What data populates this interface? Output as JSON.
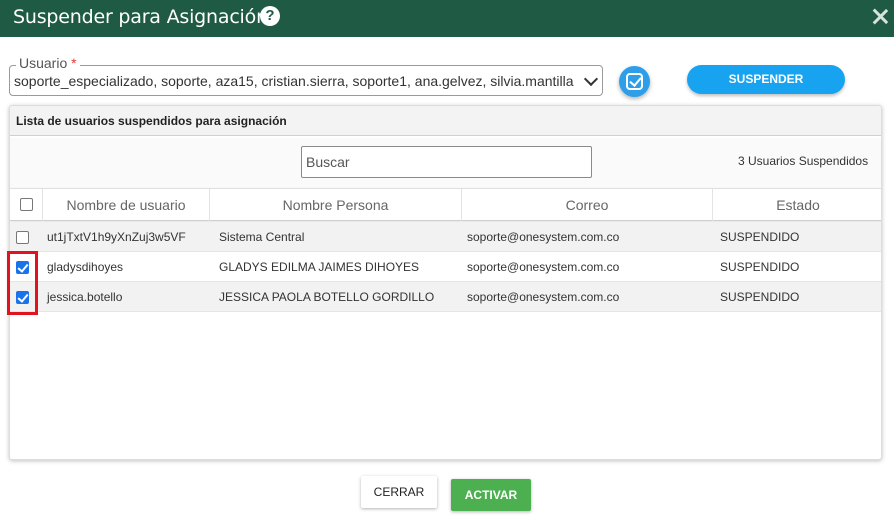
{
  "dialog": {
    "title": "Suspender para Asignación",
    "help_icon": "question-circle-icon",
    "help_glyph": "?",
    "close_icon": "close-icon"
  },
  "user_field": {
    "label": "Usuario",
    "required_mark": "*",
    "value": "soporte_especializado, soporte, aza15, cristian.sierra, soporte1, ana.gelvez, silvia.mantilla, ..."
  },
  "toolbar": {
    "select_all_icon": "check-square-icon",
    "suspend_label": "SUSPENDER"
  },
  "panel": {
    "title": "Lista de usuarios suspendidos para asignación",
    "search_placeholder": "Buscar",
    "count_text": "3 Usuarios Suspendidos",
    "columns": [
      "Nombre de usuario",
      "Nombre Persona",
      "Correo",
      "Estado"
    ],
    "rows": [
      {
        "username": "ut1jTxtV1h9yXnZuj3w5VF",
        "person": "Sistema Central",
        "email": "soporte@onesystem.com.co",
        "status": "SUSPENDIDO",
        "checked": false
      },
      {
        "username": "gladysdihoyes",
        "person": "GLADYS EDILMA JAIMES DIHOYES",
        "email": "soporte@onesystem.com.co",
        "status": "SUSPENDIDO",
        "checked": true
      },
      {
        "username": "jessica.botello",
        "person": "JESSICA PAOLA BOTELLO GORDILLO",
        "email": "soporte@onesystem.com.co",
        "status": "SUSPENDIDO",
        "checked": true
      }
    ]
  },
  "footer": {
    "close_label": "CERRAR",
    "activate_label": "ACTIVAR"
  },
  "colors": {
    "titlebar": "#1f5a45",
    "primary": "#17a3f0",
    "success": "#4caf50",
    "highlight": "#e0131f",
    "checkbox_checked": "#1a73e8"
  }
}
